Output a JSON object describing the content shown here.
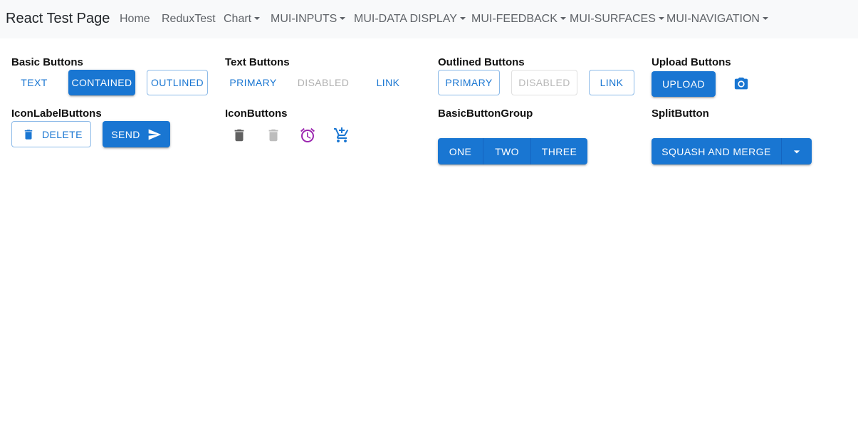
{
  "navbar": {
    "brand": "React Test Page",
    "links": [
      {
        "label": "Home",
        "dropdown": false
      },
      {
        "label": "ReduxTest",
        "dropdown": false
      },
      {
        "label": "Chart",
        "dropdown": true
      },
      {
        "label": "MUI-INPUTS",
        "dropdown": true
      },
      {
        "label": "MUI-DATA DISPLAY",
        "dropdown": true
      },
      {
        "label": "MUI-FEEDBACK",
        "dropdown": true
      },
      {
        "label": "MUI-SURFACES",
        "dropdown": true
      },
      {
        "label": "MUI-NAVIGATION",
        "dropdown": true
      }
    ]
  },
  "colors": {
    "primary": "#1976d2",
    "disabled": "#b0b0b0",
    "secondary": "#9c27b0",
    "icon_default": "#616161",
    "navbar_bg": "#f8f9fa"
  },
  "basic_buttons": {
    "heading": "Basic Buttons",
    "text": "TEXT",
    "contained": "CONTAINED",
    "outlined": "OUTLINED"
  },
  "text_buttons": {
    "heading": "Text Buttons",
    "primary": "PRIMARY",
    "disabled": "DISABLED",
    "link": "LINK"
  },
  "outlined_buttons": {
    "heading": "Outlined Buttons",
    "primary": "PRIMARY",
    "disabled": "DISABLED",
    "link": "LINK"
  },
  "upload_buttons": {
    "heading": "Upload Buttons",
    "upload": "UPLOAD",
    "camera_icon": "camera-icon"
  },
  "icon_label_buttons": {
    "heading": "IconLabelButtons",
    "delete": "DELETE",
    "send": "SEND",
    "delete_icon": "delete-icon",
    "send_icon": "send-icon"
  },
  "icon_buttons": {
    "heading": "IconButtons",
    "icons": [
      "delete-icon",
      "delete-icon-disabled",
      "alarm-icon",
      "add-shopping-cart-icon"
    ]
  },
  "basic_button_group": {
    "heading": "BasicButtonGroup",
    "buttons": [
      "ONE",
      "TWO",
      "THREE"
    ]
  },
  "split_button": {
    "heading": "SplitButton",
    "label": "SQUASH AND MERGE",
    "dropdown_icon": "arrow-drop-down-icon"
  }
}
